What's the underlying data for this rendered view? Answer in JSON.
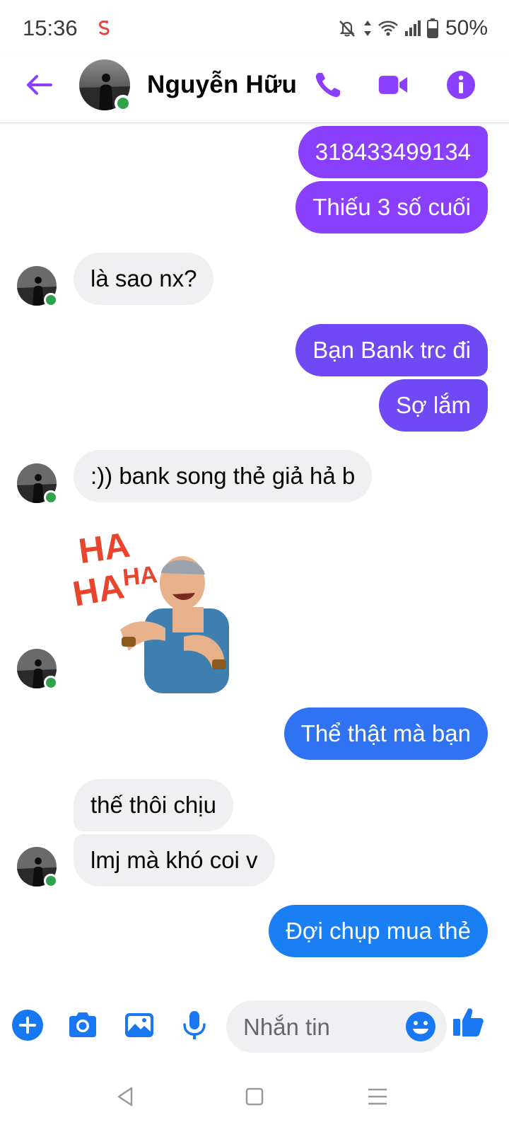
{
  "status_bar": {
    "time": "15:36",
    "battery": "50%",
    "icons": [
      "snake-app-icon",
      "mute-icon",
      "data-arrows-icon",
      "wifi-icon",
      "signal-icon",
      "battery-icon"
    ]
  },
  "header": {
    "contact_name": "Nguyễn Hữu",
    "online": true,
    "icons": [
      "back-arrow-icon",
      "phone-icon",
      "video-camera-icon",
      "info-icon"
    ],
    "accent_color": "#8a3ffc"
  },
  "messages": [
    {
      "id": "m1",
      "sender": "me",
      "text": "318433499134"
    },
    {
      "id": "m2",
      "sender": "me",
      "text": "Thiếu 3 số cuối"
    },
    {
      "id": "m3",
      "sender": "contact",
      "text": "là sao nx?"
    },
    {
      "id": "m4",
      "sender": "me",
      "text": "Bạn Bank trc đi"
    },
    {
      "id": "m5",
      "sender": "me",
      "text": "Sợ lắm"
    },
    {
      "id": "m6",
      "sender": "contact",
      "text": ":)) bank song thẻ giả hả b"
    },
    {
      "id": "m7",
      "sender": "contact",
      "type": "sticker",
      "sticker_text": "HA HA HA"
    },
    {
      "id": "m8",
      "sender": "me",
      "text": "Thể thật mà bạn"
    },
    {
      "id": "m9",
      "sender": "contact",
      "text": "thế thôi chịu"
    },
    {
      "id": "m10",
      "sender": "contact",
      "text": "lmj mà khó coi v"
    },
    {
      "id": "m11",
      "sender": "me",
      "text": "Đợi chụp mua thẻ"
    }
  ],
  "composer": {
    "placeholder": "Nhắn tin",
    "icons": [
      "plus-icon",
      "camera-icon",
      "image-icon",
      "microphone-icon",
      "emoji-icon",
      "thumbs-up-icon"
    ],
    "icon_color": "#1877f2"
  },
  "navbar": {
    "icons": [
      "nav-back-icon",
      "nav-home-icon",
      "nav-menu-icon"
    ]
  }
}
